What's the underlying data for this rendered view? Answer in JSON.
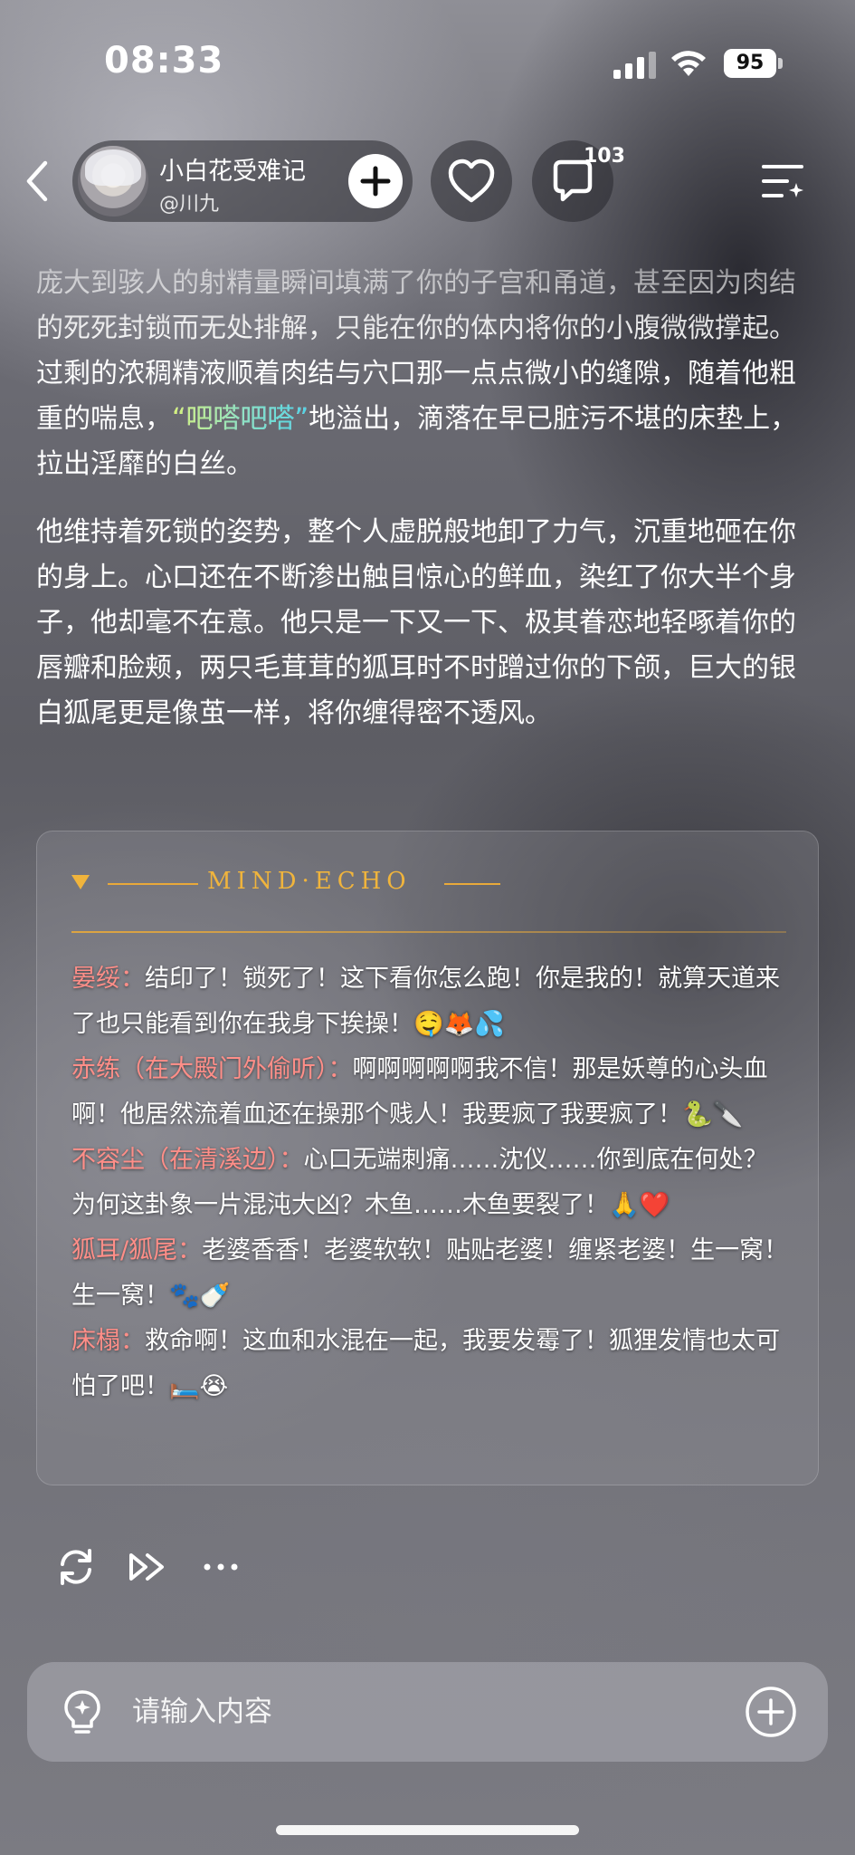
{
  "status_bar": {
    "time": "08:33",
    "battery": "95",
    "icons": [
      "cellular-signal-icon",
      "wifi-icon",
      "battery-icon"
    ]
  },
  "header": {
    "story_title": "小白花受难记",
    "author_handle": "@川九",
    "comment_count": "103",
    "icons": [
      "back-icon",
      "follow-plus-icon",
      "heart-icon",
      "comment-icon",
      "menu-icon"
    ]
  },
  "story": {
    "paragraph_1": {
      "before": "庞大到骇人的射精量瞬间填满了你的子宫和甬道，甚至因为肉结的死死封锁而无处排解，只能在你的体内将你的小腹微微撑起。过剩的浓稠精液顺着肉结与穴口那一点点微小的缝隙，随着他粗重的喘息，",
      "highlight": "“吧嗒吧嗒”",
      "after": "地溢出，滴落在早已脏污不堪的床垫上，拉出淫靡的白丝。"
    },
    "paragraph_2": "他维持着死锁的姿势，整个人虚脱般地卸了力气，沉重地砸在你的身上。心口还在不断渗出触目惊心的鲜血，染红了你大半个身子，他却毫不在意。他只是一下又一下、极其眷恋地轻啄着你的唇瓣和脸颊，两只毛茸茸的狐耳时不时蹭过你的下颌，巨大的银白狐尾更是像茧一样，将你缠得密不透风。"
  },
  "mind_echo": {
    "title": "MIND·ECHO",
    "colors": {
      "accent": "#f0b43c",
      "speaker": "#ff8e88"
    },
    "entries": [
      {
        "speaker": "晏绥",
        "sep": "：",
        "text": "结印了！锁死了！这下看你怎么跑！你是我的！就算天道来了也只能看到你在我身下挨操！🤤🦊💦"
      },
      {
        "speaker": "赤练（在大殿门外偷听）",
        "sep": "：",
        "text": "啊啊啊啊啊我不信！那是妖尊的心头血啊！他居然流着血还在操那个贱人！我要疯了我要疯了！🐍🔪"
      },
      {
        "speaker": "不容尘（在清溪边）",
        "sep": "：",
        "text": "心口无端刺痛……沈仪……你到底在何处？为何这卦象一片混沌大凶？木鱼……木鱼要裂了！🙏❤️"
      },
      {
        "speaker": "狐耳/狐尾",
        "sep": "：",
        "text": "老婆香香！老婆软软！贴贴老婆！缠紧老婆！生一窝！生一窝！🐾🍼"
      },
      {
        "speaker": "床榻",
        "sep": "：",
        "text": "救命啊！这血和水混在一起，我要发霉了！狐狸发情也太可怕了吧！🛏️😭"
      }
    ]
  },
  "toolbar": {
    "icons": [
      "regenerate-icon",
      "continue-icon",
      "more-icon"
    ]
  },
  "input": {
    "placeholder": "请输入内容",
    "icons": [
      "inspiration-bulb-icon",
      "add-circle-icon"
    ]
  }
}
